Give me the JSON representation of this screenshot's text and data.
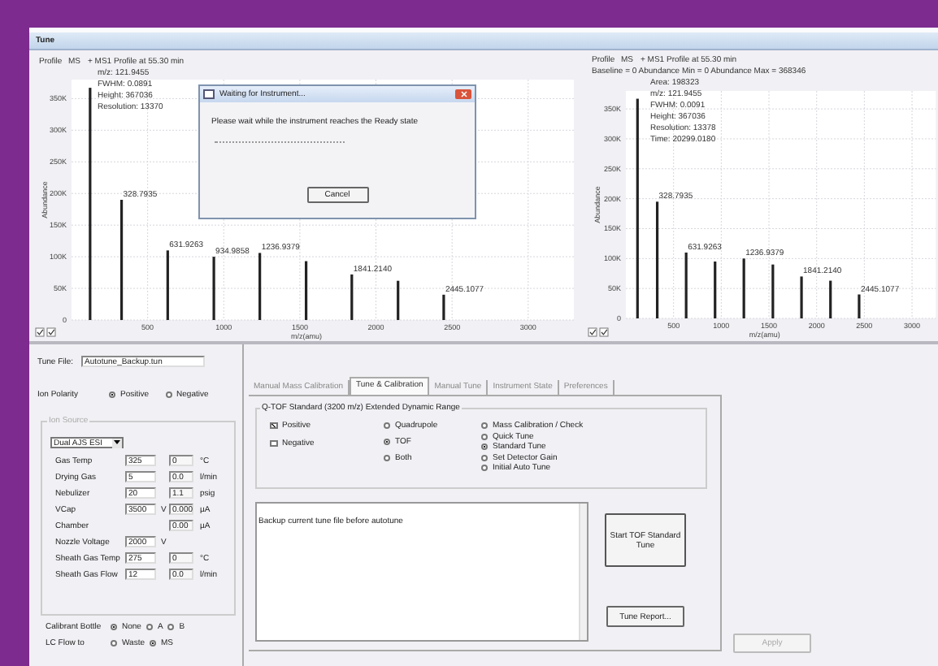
{
  "window": {
    "title": "Tune"
  },
  "spectra": [
    {
      "mode": "Profile",
      "scan": "MS",
      "description": "+ MS1 Profile at 55.30 min",
      "info": [
        "m/z: 121.9455",
        "FWHM: 0.0891",
        "Height: 367036",
        "Resolution: 13370"
      ],
      "chart_data": {
        "type": "bar",
        "xlabel": "m/z(amu)",
        "ylabel": "Abundance",
        "xlim": [
          0,
          3300
        ],
        "ylim": [
          0,
          380000
        ],
        "x": [
          121.9455,
          328.7935,
          631.9263,
          934.9858,
          1236.9379,
          1541,
          1841.214,
          2145,
          2445.1077
        ],
        "values": [
          367036,
          190000,
          110000,
          100000,
          106000,
          93000,
          72000,
          62000,
          40000
        ],
        "grid": true,
        "xticks": [
          500,
          1000,
          1500,
          2000,
          2500,
          3000
        ],
        "yticks": [
          {
            "value": 0,
            "label": "0"
          },
          {
            "value": 50000,
            "label": "50K"
          },
          {
            "value": 100000,
            "label": "100K"
          },
          {
            "value": 150000,
            "label": "150K"
          },
          {
            "value": 200000,
            "label": "200K"
          },
          {
            "value": 250000,
            "label": "250K"
          },
          {
            "value": 300000,
            "label": "300K"
          },
          {
            "value": 350000,
            "label": "350K"
          }
        ],
        "annotations": [
          {
            "x": 328.7935,
            "y": 190000,
            "text": "328.7935"
          },
          {
            "x": 631.9263,
            "y": 110000,
            "text": "631.9263"
          },
          {
            "x": 934.9858,
            "y": 100000,
            "text": "934.9858"
          },
          {
            "x": 1236.9379,
            "y": 106000,
            "text": "1236.9379"
          },
          {
            "x": 1841.214,
            "y": 72000,
            "text": "1841.2140"
          },
          {
            "x": 2445.1077,
            "y": 40000,
            "text": "2445.1077"
          }
        ]
      }
    },
    {
      "mode": "Profile",
      "scan": "MS",
      "description": "+ MS1 Profile at 55.30 min",
      "summary": "Baseline = 0   Abundance Min = 0   Abundance Max = 368346",
      "info": [
        "Area: 198323",
        "m/z: 121.9455",
        "FWHM: 0.0091",
        "Height: 367036",
        "Resolution: 13378",
        "Time: 20299.0180"
      ],
      "chart_data": {
        "type": "bar",
        "xlabel": "m/z(amu)",
        "ylabel": "Abundance",
        "xlim": [
          0,
          3250
        ],
        "ylim": [
          0,
          380000
        ],
        "x": [
          121.9455,
          328.7935,
          631.9263,
          934.9858,
          1236.9379,
          1541,
          1841.214,
          2145,
          2445.1077
        ],
        "values": [
          367036,
          195000,
          110000,
          95000,
          100000,
          90000,
          70000,
          63000,
          40000
        ],
        "grid": true,
        "xticks": [
          500,
          1000,
          1500,
          2000,
          2500,
          3000
        ],
        "yticks": [
          {
            "value": 0,
            "label": "0"
          },
          {
            "value": 50000,
            "label": "50K"
          },
          {
            "value": 100000,
            "label": "100K"
          },
          {
            "value": 150000,
            "label": "150K"
          },
          {
            "value": 200000,
            "label": "200K"
          },
          {
            "value": 250000,
            "label": "250K"
          },
          {
            "value": 300000,
            "label": "300K"
          },
          {
            "value": 350000,
            "label": "350K"
          }
        ],
        "annotations": [
          {
            "x": 328.7935,
            "y": 195000,
            "text": "328.7935"
          },
          {
            "x": 631.9263,
            "y": 110000,
            "text": "631.9263"
          },
          {
            "x": 1236.9379,
            "y": 100000,
            "text": "1236.9379"
          },
          {
            "x": 1841.214,
            "y": 70000,
            "text": "1841.2140"
          },
          {
            "x": 2445.1077,
            "y": 40000,
            "text": "2445.1077"
          }
        ]
      }
    }
  ],
  "dialog": {
    "title": "Waiting for Instrument...",
    "message": "Please wait while the instrument reaches the Ready state",
    "buttons": [
      "Cancel"
    ]
  },
  "tune_file": {
    "label": "Tune File:",
    "value": "Autotune_Backup.tun"
  },
  "ion_polarity": {
    "label": "Ion Polarity",
    "options": [
      {
        "label": "Positive",
        "selected": true
      },
      {
        "label": "Negative",
        "selected": false
      }
    ]
  },
  "ion_source": {
    "title": "Ion Source",
    "source": "Dual AJS ESI",
    "params": [
      {
        "label": "Gas Temp",
        "setpoint": "325",
        "actual": "0",
        "unit": "°C"
      },
      {
        "label": "Drying Gas",
        "setpoint": "5",
        "actual": "0.0",
        "unit": "l/min"
      },
      {
        "label": "Nebulizer",
        "setpoint": "20",
        "actual": "1.1",
        "unit": "psig"
      },
      {
        "label": "VCap",
        "setpoint": "3500",
        "setpoint_unit": "V",
        "actual": "0.000",
        "unit": "µA"
      },
      {
        "label": "Chamber",
        "actual": "0.00",
        "unit": "µA"
      },
      {
        "label": "Nozzle Voltage",
        "setpoint": "2000",
        "setpoint_unit": "V"
      },
      {
        "label": "Sheath Gas Temp",
        "setpoint": "275",
        "actual": "0",
        "unit": "°C"
      },
      {
        "label": "Sheath Gas Flow",
        "setpoint": "12",
        "actual": "0.0",
        "unit": "l/min"
      }
    ]
  },
  "calibrant_bottle": {
    "label": "Calibrant Bottle",
    "options": [
      {
        "label": "None",
        "selected": true
      },
      {
        "label": "A",
        "selected": false
      },
      {
        "label": "B",
        "selected": false
      }
    ]
  },
  "lc_flow": {
    "label": "LC Flow to",
    "options": [
      {
        "label": "Waste",
        "selected": false
      },
      {
        "label": "MS",
        "selected": true
      }
    ]
  },
  "tabs": [
    {
      "label": "Manual Mass Calibration",
      "selected": false
    },
    {
      "label": "Tune & Calibration",
      "selected": true
    },
    {
      "label": "Manual Tune",
      "selected": false
    },
    {
      "label": "Instrument State",
      "selected": false
    },
    {
      "label": "Preferences",
      "selected": false
    }
  ],
  "tune_calibration": {
    "group_title": "Q-TOF   Standard (3200 m/z) Extended Dynamic Range",
    "polarity": [
      {
        "label": "Positive",
        "checked": true
      },
      {
        "label": "Negative",
        "checked": false
      }
    ],
    "analyzer": [
      {
        "label": "Quadrupole",
        "selected": false
      },
      {
        "label": "TOF",
        "selected": true
      },
      {
        "label": "Both",
        "selected": false
      }
    ],
    "tune_type": [
      {
        "label": "Mass Calibration / Check",
        "selected": false
      },
      {
        "label": "Quick Tune",
        "selected": false
      },
      {
        "label": "Standard Tune",
        "selected": true
      },
      {
        "label": "Set Detector Gain",
        "selected": false
      },
      {
        "label": "Initial Auto Tune",
        "selected": false
      }
    ],
    "log": "Backup current tune file before autotune",
    "start_button": "Start TOF Standard Tune",
    "report_button": "Tune Report..."
  },
  "apply_button": {
    "label": "Apply",
    "disabled": true
  }
}
